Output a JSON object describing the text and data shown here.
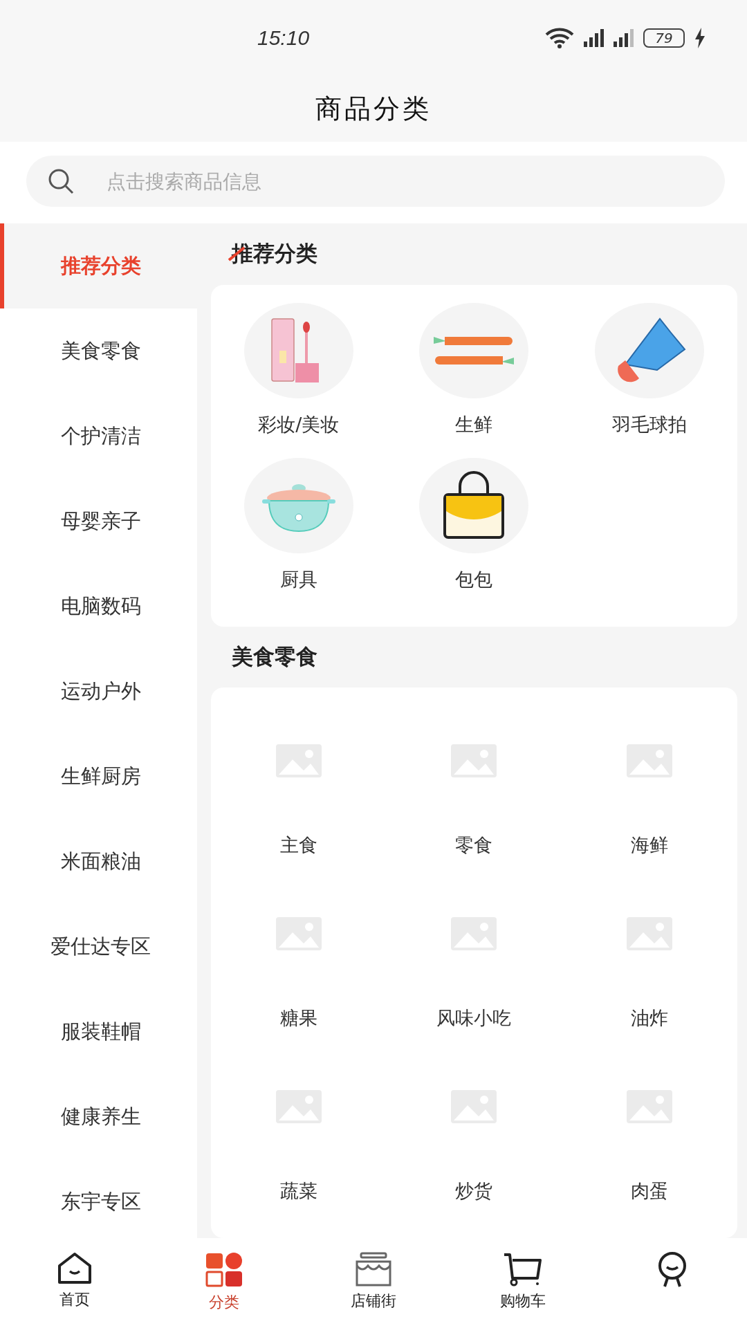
{
  "status_bar": {
    "time": "15:10",
    "battery": "79"
  },
  "header": {
    "title": "商品分类"
  },
  "search": {
    "placeholder": "点击搜索商品信息"
  },
  "sidebar": {
    "items": [
      {
        "label": "推荐分类",
        "selected": true
      },
      {
        "label": "美食零食",
        "selected": false
      },
      {
        "label": "个护清洁",
        "selected": false
      },
      {
        "label": "母婴亲子",
        "selected": false
      },
      {
        "label": "电脑数码",
        "selected": false
      },
      {
        "label": "运动户外",
        "selected": false
      },
      {
        "label": "生鲜厨房",
        "selected": false
      },
      {
        "label": "米面粮油",
        "selected": false
      },
      {
        "label": "爱仕达专区",
        "selected": false
      },
      {
        "label": "服装鞋帽",
        "selected": false
      },
      {
        "label": "健康养生",
        "selected": false
      },
      {
        "label": "东宇专区",
        "selected": false
      }
    ]
  },
  "sections": [
    {
      "title": "推荐分类",
      "active": true,
      "items": [
        {
          "label": "彩妆/美妆"
        },
        {
          "label": "生鲜"
        },
        {
          "label": "羽毛球拍"
        },
        {
          "label": "厨具"
        },
        {
          "label": "包包"
        }
      ]
    },
    {
      "title": "美食零食",
      "active": false,
      "items": [
        {
          "label": "主食"
        },
        {
          "label": "零食"
        },
        {
          "label": "海鲜"
        },
        {
          "label": "糖果"
        },
        {
          "label": "风味小吃"
        },
        {
          "label": "油炸"
        },
        {
          "label": "蔬菜"
        },
        {
          "label": "炒货"
        },
        {
          "label": "肉蛋"
        }
      ]
    }
  ],
  "tab_bar": [
    {
      "label": "首页",
      "selected": false
    },
    {
      "label": "分类",
      "selected": true
    },
    {
      "label": "店铺街",
      "selected": false
    },
    {
      "label": "购物车",
      "selected": false
    },
    {
      "selected": false
    }
  ]
}
